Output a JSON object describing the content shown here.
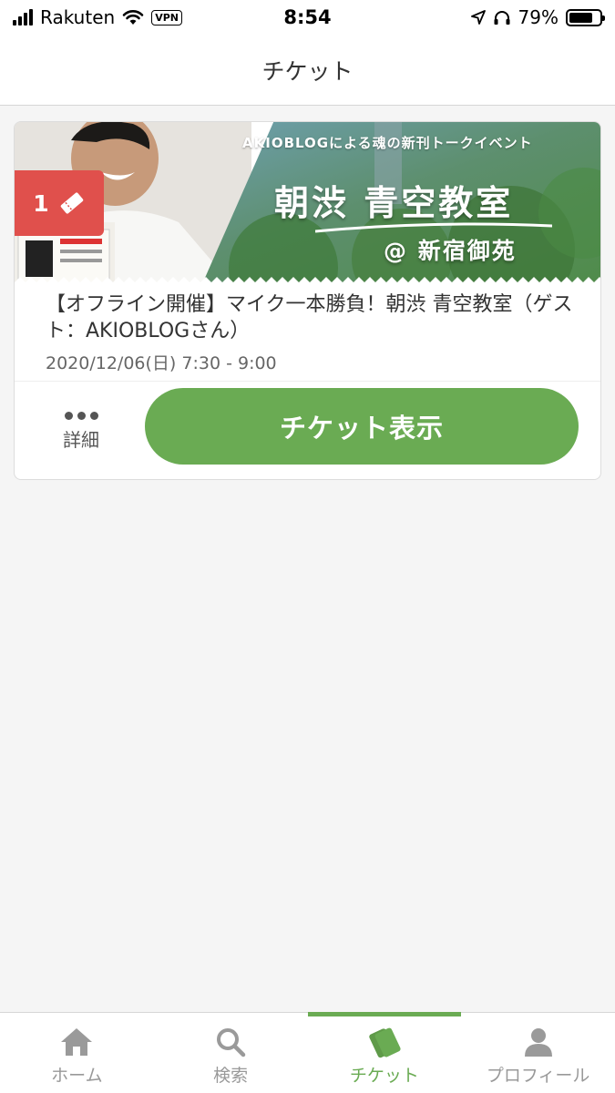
{
  "status_bar": {
    "carrier": "Rakuten",
    "vpn": "VPN",
    "time": "8:54",
    "battery": "79%",
    "battery_level": 0.79
  },
  "header": {
    "title": "チケット"
  },
  "ticket": {
    "banner": {
      "line1": "AKIOBLOGによる魂の新刊トークイベント",
      "title": "朝渋 青空教室",
      "subtitle": "@ 新宿御苑"
    },
    "badge_count": "1",
    "title": "【オフライン開催】マイク一本勝負！朝渋 青空教室（ゲスト：AKIOBLOGさん）",
    "date": "2020/12/06(日) 7:30 - 9:00",
    "detail_label": "詳細",
    "show_button_label": "チケット表示"
  },
  "tabs": [
    {
      "label": "ホーム",
      "icon": "home-icon",
      "active": false
    },
    {
      "label": "検索",
      "icon": "search-icon",
      "active": false
    },
    {
      "label": "チケット",
      "icon": "ticket-icon",
      "active": true
    },
    {
      "label": "プロフィール",
      "icon": "profile-icon",
      "active": false
    }
  ],
  "colors": {
    "accent": "#6aab53",
    "badge": "#e0504c",
    "inactive_tab": "#999999"
  }
}
